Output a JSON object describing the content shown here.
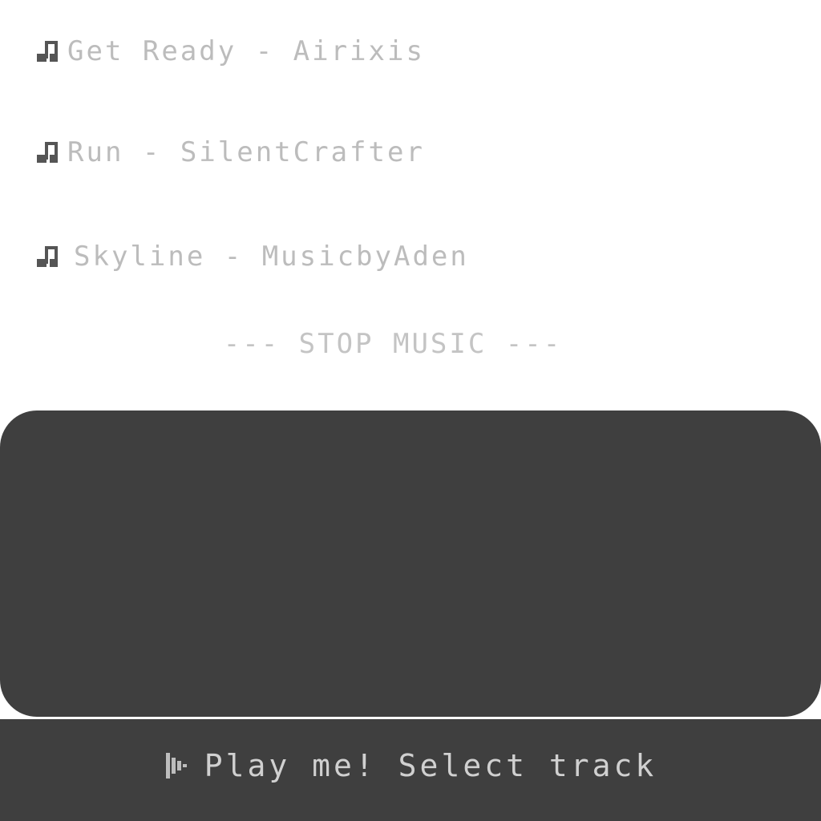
{
  "tracks": [
    {
      "label": "Get Ready - Airixis",
      "icon": "music-note-icon"
    },
    {
      "label": "Run - SilentCrafter",
      "icon": "music-note-icon"
    },
    {
      "label": "Skyline - MusicbyAden",
      "icon": "music-note-icon"
    }
  ],
  "stop_label": "--- STOP MUSIC ---",
  "status": {
    "icon": "play-icon",
    "text": "Play me! Select track"
  },
  "colors": {
    "panel": "#3f3f3f",
    "text_dim": "#bcbcbc",
    "text_status": "#d0d0d0",
    "icon": "#555555"
  }
}
